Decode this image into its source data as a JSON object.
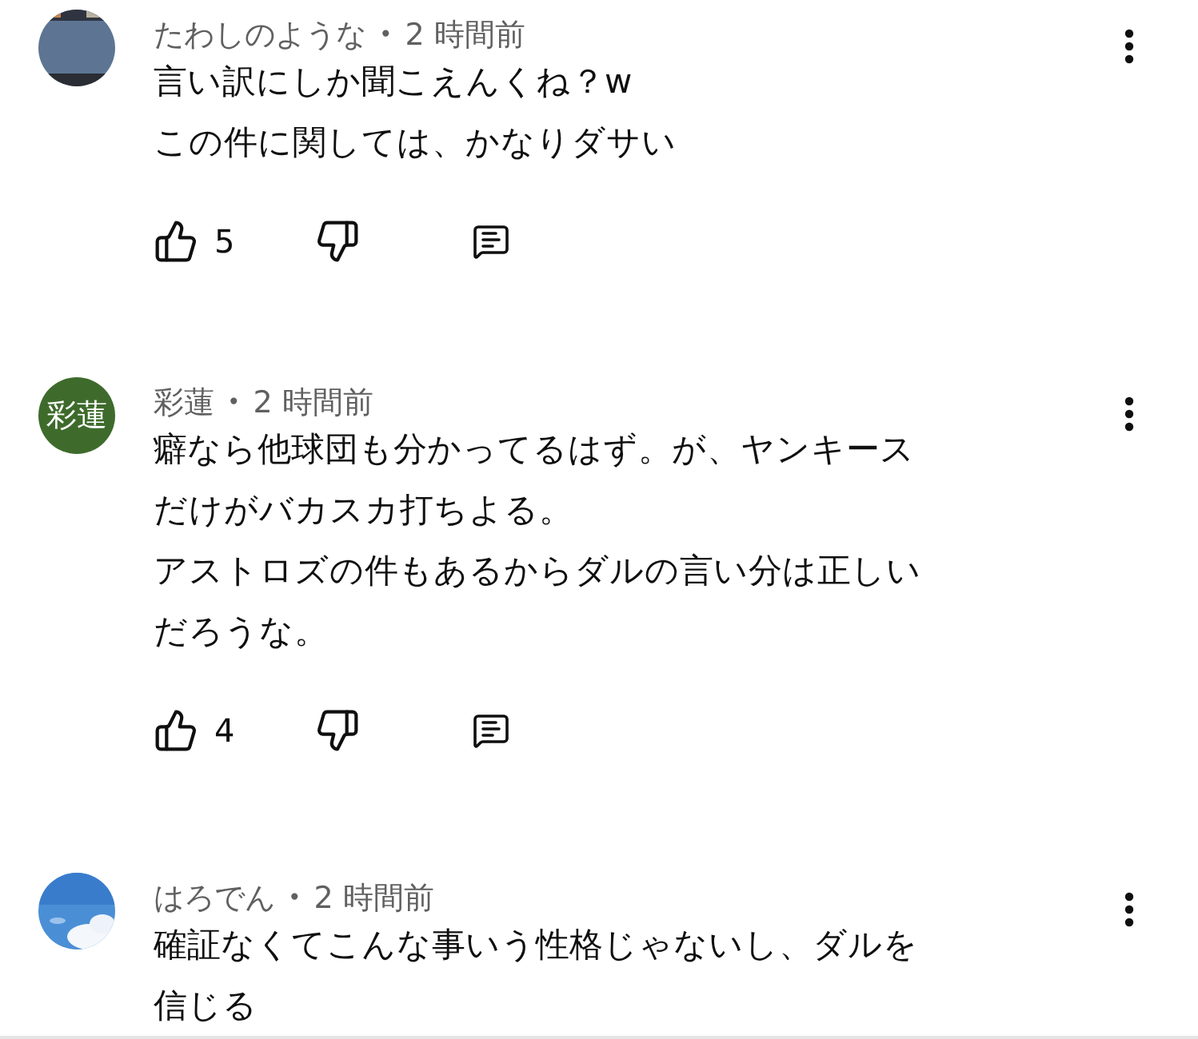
{
  "comments": [
    {
      "author": "たわしのような",
      "time": "2 時間前",
      "avatar": {
        "kind": "picture"
      },
      "lines": [
        "言い訳にしか聞こえんくね？w",
        "この件に関しては、かなりダサい"
      ],
      "likes": "5"
    },
    {
      "author": "彩蓮",
      "time": "2 時間前",
      "avatar": {
        "kind": "initials",
        "text": "彩蓮",
        "color": "#3e6b2c"
      },
      "lines": [
        "癖なら他球団も分かってるはず。が、ヤンキース",
        "だけがバカスカ打ちよる。",
        "アストロズの件もあるからダルの言い分は正しい",
        "だろうな。"
      ],
      "likes": "4"
    },
    {
      "author": "はろでん",
      "time": "2 時間前",
      "avatar": {
        "kind": "picture"
      },
      "lines": [
        "確証なくてこんな事いう性格じゃないし、ダルを",
        "信じる"
      ]
    }
  ],
  "separator": "•"
}
